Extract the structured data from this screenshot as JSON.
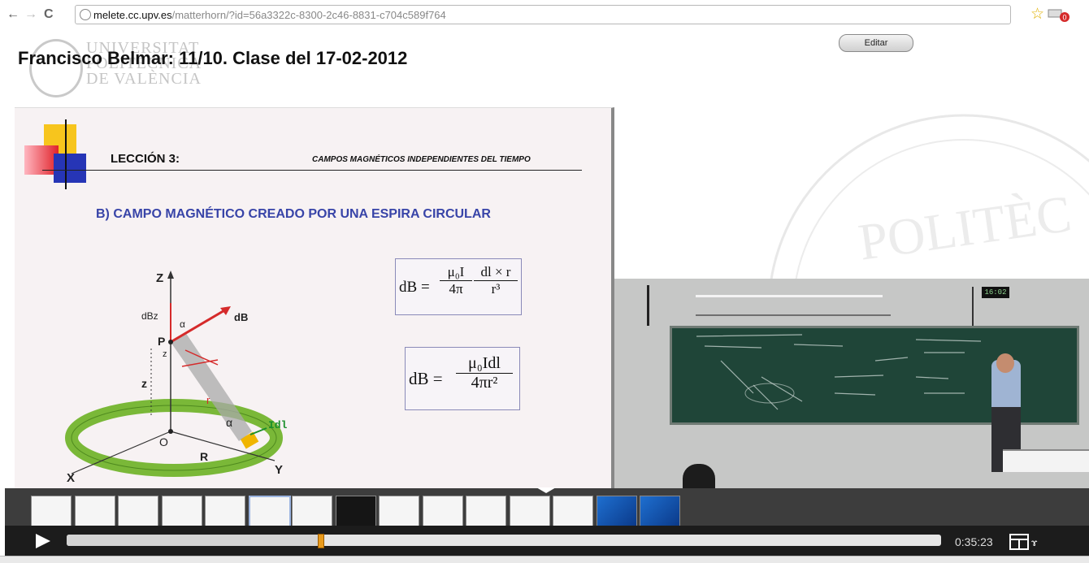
{
  "browser": {
    "url_host": "melete.cc.upv.es",
    "url_path": "/matterhorn/?id=56a3322c-8300-2c46-8831-c704c589f764",
    "icons": [
      "back-arrow-icon",
      "forward-arrow-icon",
      "reload-icon",
      "globe-icon",
      "star-icon",
      "extension-icon"
    ]
  },
  "page": {
    "title": "Francisco Belmar: 11/10. Clase del 17-02-2012",
    "edit_label": "Editar",
    "logo_text": [
      "UNIVERSITAT",
      "POLITÈCNICA",
      "DE VALÈNCIA"
    ],
    "watermark": "POLITÈC"
  },
  "slide": {
    "lesson": "LECCIÓN 3:",
    "lesson_subtitle": "CAMPOS MAGNÉTICOS INDEPENDIENTES DEL TIEMPO",
    "heading": "B) CAMPO MAGNÉTICO CREADO POR UNA ESPIRA CIRCULAR",
    "diagram_labels": {
      "z_axis": "Z",
      "y_axis": "Y",
      "x_axis": "X",
      "dbz": "dBz",
      "db": "dB",
      "alpha_top": "α",
      "p": "P",
      "z_small": "z",
      "z": "z",
      "r_vec": "r",
      "alpha_bottom": "α",
      "idl": "Idl",
      "o": "O",
      "r": "R"
    },
    "formula1": {
      "lhs": "dB",
      "num1": "μ₀I",
      "den1": "4π",
      "num2": "dl × r",
      "den2": "r³"
    },
    "formula2": {
      "lhs": "dB =",
      "num": "μ₀Idl",
      "den": "4πr²"
    }
  },
  "video": {
    "clock": "16:02"
  },
  "player": {
    "time": "0:35:23",
    "progress": 0.29,
    "thumb_count": 15,
    "icons": [
      "play-icon",
      "layout-icon"
    ]
  },
  "colors": {
    "slide_heading": "#3844a8",
    "handle": "#e89a1b",
    "board": "#1f4538"
  }
}
